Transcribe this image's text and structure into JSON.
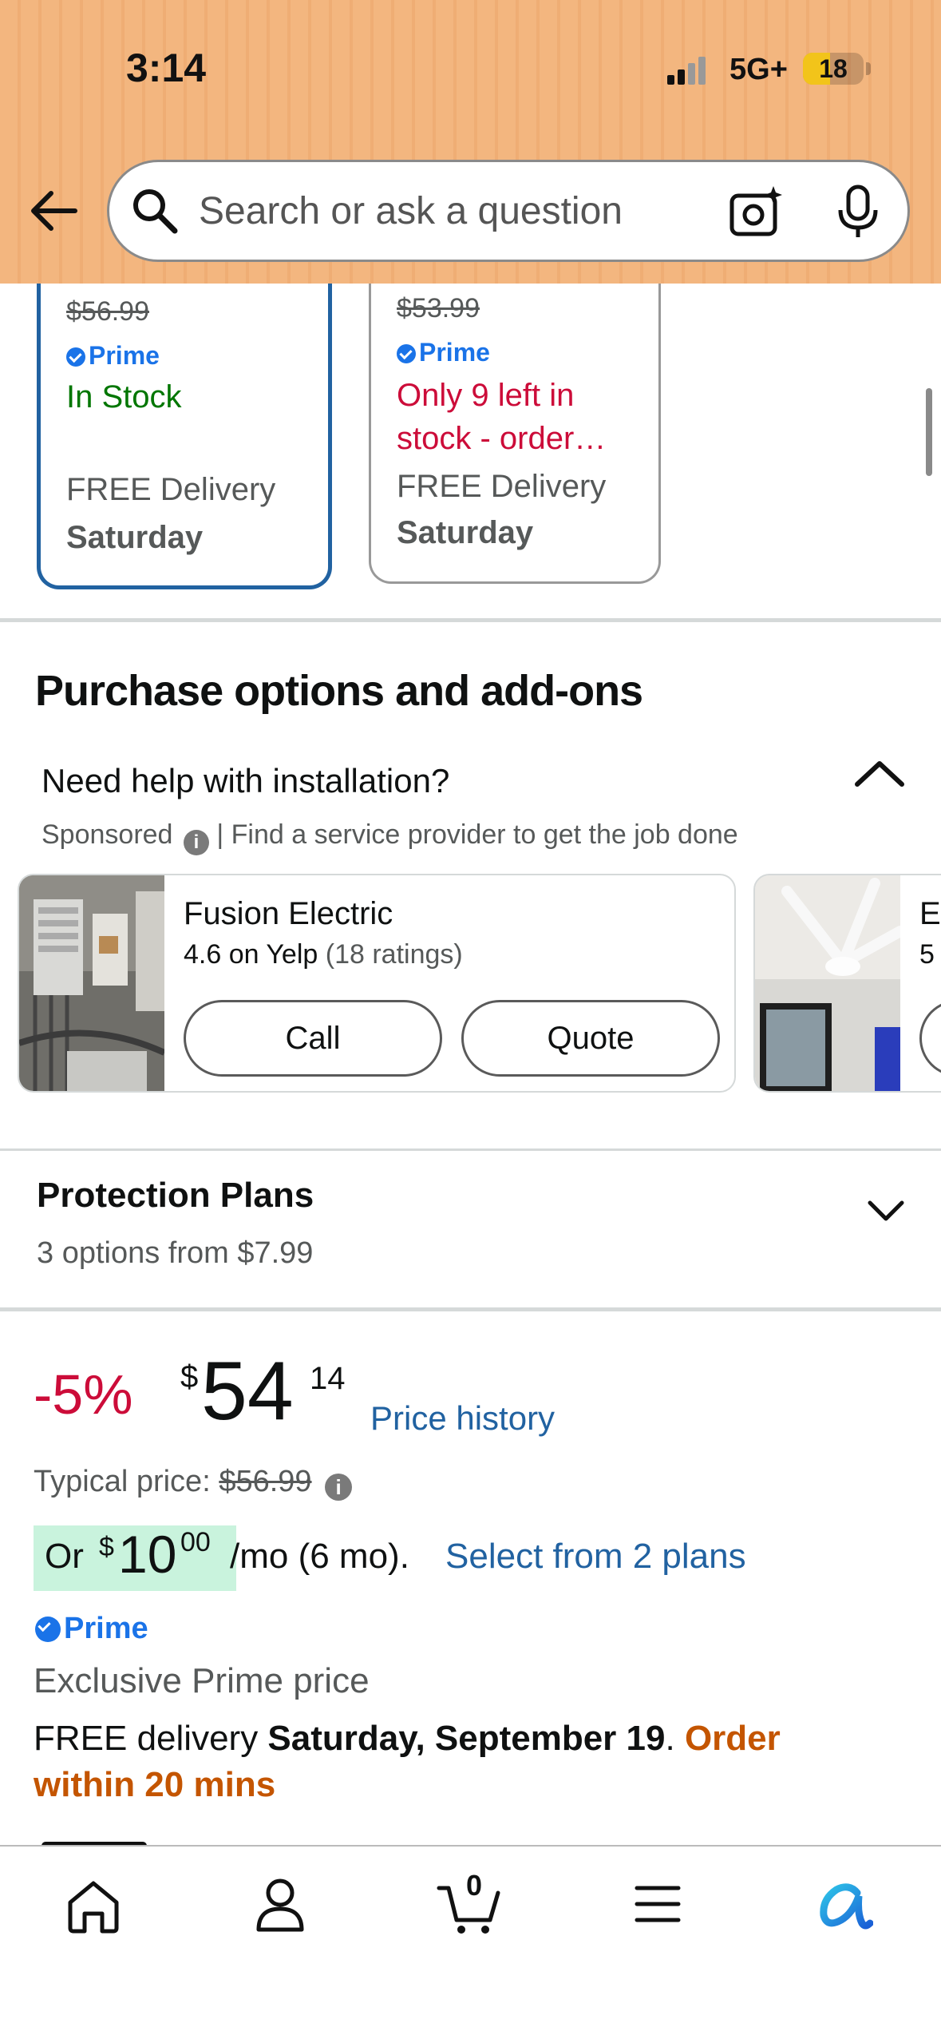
{
  "status_bar": {
    "time": "3:14",
    "network": "5G+",
    "battery": "18"
  },
  "search": {
    "placeholder": "Search or ask a question"
  },
  "offers": [
    {
      "old_price": "$56.99",
      "prime": "Prime",
      "stock": "In Stock",
      "delivery_label": "FREE Delivery",
      "delivery_day": "Saturday"
    },
    {
      "old_price": "$53.99",
      "prime": "Prime",
      "stock_line1": "Only 9 left in",
      "stock_line2": "stock - order…",
      "delivery_label": "FREE Delivery",
      "delivery_day": "Saturday"
    }
  ],
  "purchase_options": {
    "heading": "Purchase options and add-ons",
    "install_question": "Need help with installation?",
    "sponsored": "Sponsored",
    "sponsored_note": "| Find a service provider to get the job done",
    "providers": [
      {
        "name": "Fusion Electric",
        "rating": "4.6 on Yelp",
        "rating_count": "(18 ratings)",
        "call": "Call",
        "quote": "Quote"
      },
      {
        "name_partial": "E",
        "rating_partial": "5"
      }
    ]
  },
  "protection": {
    "title": "Protection Plans",
    "subtitle": "3 options from $7.99"
  },
  "price": {
    "discount": "-5%",
    "currency": "$",
    "whole": "54",
    "fraction": "14",
    "history_link": "Price history",
    "typical_label": "Typical price:",
    "typical_value": "$56.99",
    "monthly_or": "Or",
    "monthly_currency": "$",
    "monthly_whole": "10",
    "monthly_fraction": "00",
    "monthly_term": "/mo (6 mo).",
    "plans_link": "Select from 2 plans",
    "prime": "Prime",
    "exclusive": "Exclusive Prime price",
    "delivery_prefix": "FREE delivery",
    "delivery_date": "Saturday, September 19",
    "delivery_sep": ".",
    "order_within_1": "Order",
    "order_within_2": "within 20 mins"
  },
  "bottom_nav": {
    "cart_count": "0",
    "items": [
      "home-icon",
      "account-icon",
      "cart-icon",
      "menu-icon",
      "rufus-icon"
    ]
  },
  "colors": {
    "header": "#f3b67f",
    "link": "#2162a1",
    "deal": "#cc0c39",
    "instock": "#007600",
    "urgent": "#c45500",
    "prime": "#1a73e8",
    "selected_border": "#2162a1"
  }
}
